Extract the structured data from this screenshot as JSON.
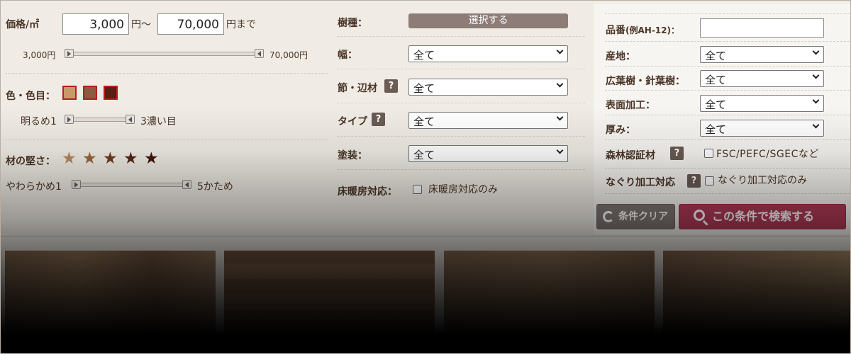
{
  "price": {
    "label": "価格/㎡",
    "min_value": "3,000",
    "between": "円〜",
    "max_value": "70,000",
    "suffix": "円まで",
    "slider_min_label": "3,000円",
    "slider_max_label": "70,000円",
    "slider_min_fraction": 0,
    "slider_max_fraction": 1
  },
  "color": {
    "label": "色・色目：",
    "swatches": [
      "#c89a6a",
      "#8d5a40",
      "#5a1e12"
    ],
    "slider_left_label": "明るめ1",
    "slider_right_label": "3濃い目"
  },
  "hardness": {
    "label": "材の堅さ：",
    "star_colors": [
      "#b8895f",
      "#96653f",
      "#6e3a25",
      "#55261a",
      "#40150e"
    ],
    "slider_left_label": "やわらかめ1",
    "slider_right_label": "5かため"
  },
  "wood_type": {
    "label": "樹種：",
    "button": "選択する"
  },
  "width": {
    "label": "幅：",
    "value": "全て"
  },
  "knot": {
    "label": "節・辺材",
    "value": "全て"
  },
  "type": {
    "label": "タイプ",
    "value": "全て"
  },
  "finish": {
    "label": "塗装：",
    "value": "全て"
  },
  "floor_heating": {
    "label": "床暖房対応：",
    "option": "床暖房対応のみ"
  },
  "product_no": {
    "label": "品番",
    "hint": "(例AH-12)：",
    "value": ""
  },
  "origin": {
    "label": "産地：",
    "value": "全て"
  },
  "tree_kind": {
    "label": "広葉樹・針葉樹：",
    "value": "全て"
  },
  "surface": {
    "label": "表面加工：",
    "value": "全て"
  },
  "thickness": {
    "label": "厚み：",
    "value": "全て"
  },
  "forest_cert": {
    "label": "森林認証材",
    "option": "FSC/PEFC/SGECなど"
  },
  "naguri": {
    "label": "なぐり加工対応",
    "option": "なぐり加工対応のみ"
  },
  "help_mark": "?",
  "buttons": {
    "clear": "条件クリア",
    "search": "この条件で検索する"
  },
  "accent": "#b23a57"
}
